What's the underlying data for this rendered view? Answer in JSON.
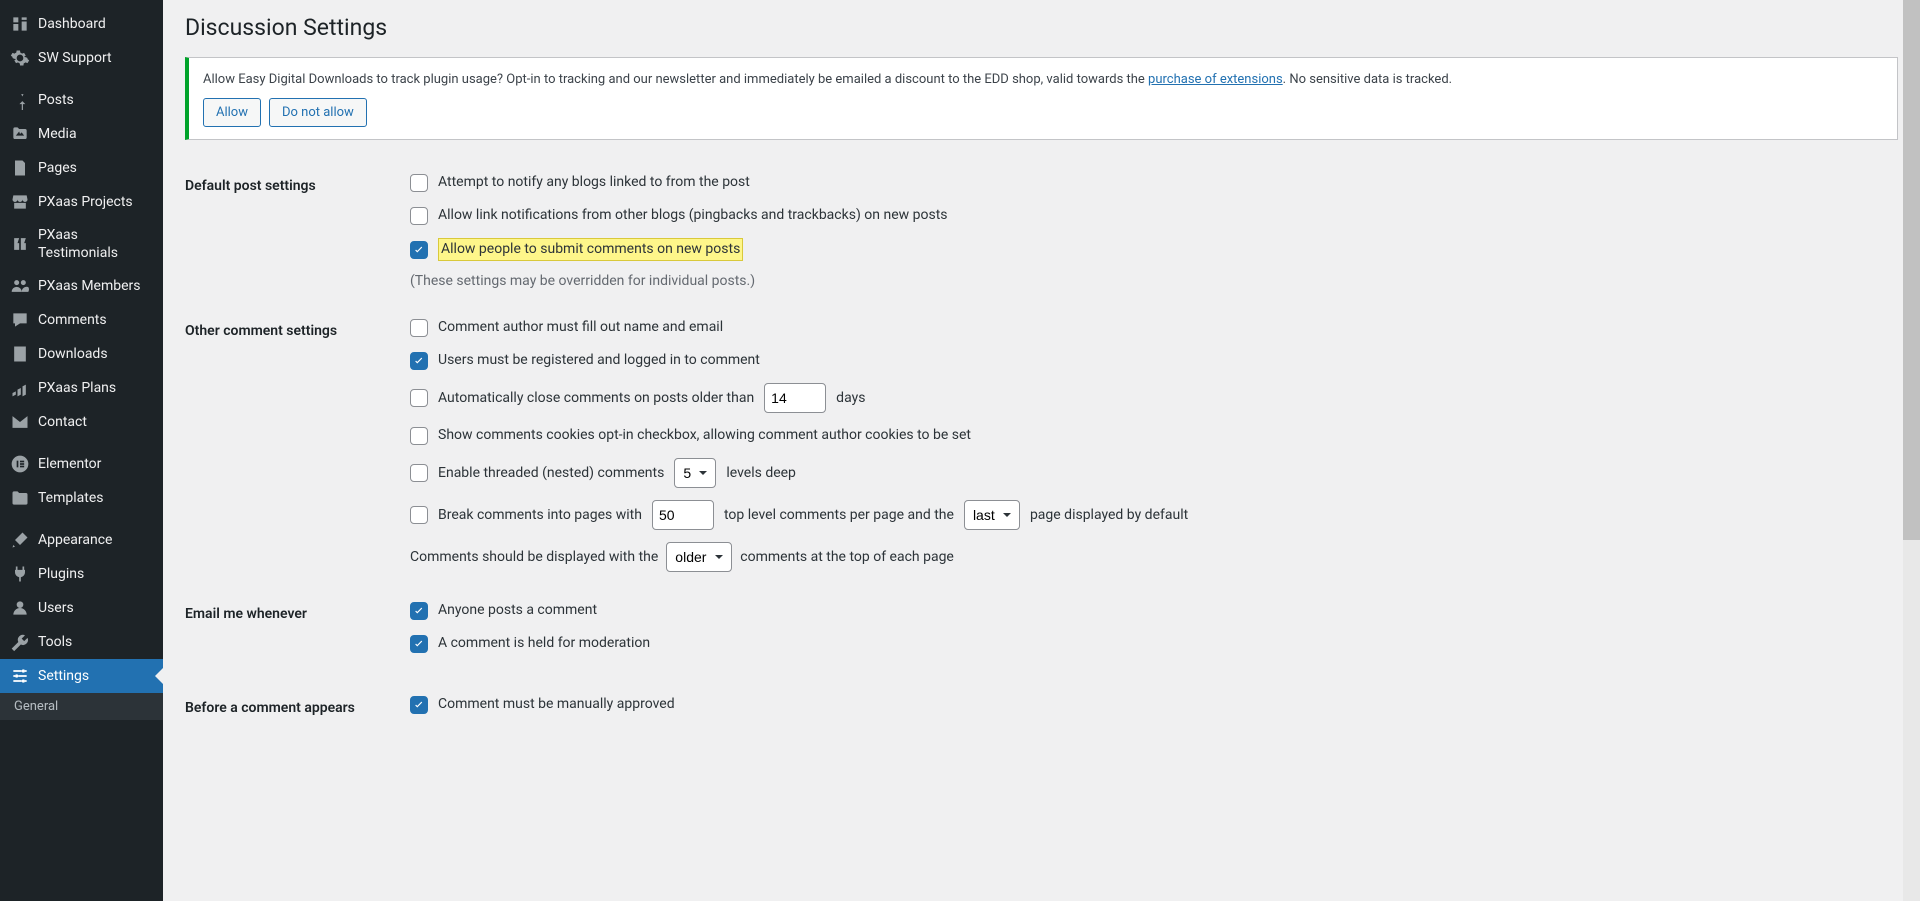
{
  "sidebar": {
    "items": [
      {
        "label": "Dashboard",
        "icon": "dash"
      },
      {
        "label": "SW Support",
        "icon": "gear"
      },
      {
        "label": "Posts",
        "icon": "pin"
      },
      {
        "label": "Media",
        "icon": "media"
      },
      {
        "label": "Pages",
        "icon": "page"
      },
      {
        "label": "PXaas Projects",
        "icon": "store"
      },
      {
        "label": "PXaas Testimonials",
        "icon": "quote"
      },
      {
        "label": "PXaas Members",
        "icon": "users"
      },
      {
        "label": "Comments",
        "icon": "comment"
      },
      {
        "label": "Downloads",
        "icon": "download"
      },
      {
        "label": "PXaas Plans",
        "icon": "plans"
      },
      {
        "label": "Contact",
        "icon": "mail"
      },
      {
        "label": "Elementor",
        "icon": "elementor"
      },
      {
        "label": "Templates",
        "icon": "folder"
      },
      {
        "label": "Appearance",
        "icon": "brush"
      },
      {
        "label": "Plugins",
        "icon": "plug"
      },
      {
        "label": "Users",
        "icon": "user"
      },
      {
        "label": "Tools",
        "icon": "wrench"
      },
      {
        "label": "Settings",
        "icon": "settings",
        "current": true
      }
    ],
    "sub_items": [
      {
        "label": "General"
      }
    ]
  },
  "page": {
    "title": "Discussion Settings"
  },
  "notice": {
    "text_before": "Allow Easy Digital Downloads to track plugin usage? Opt-in to tracking and our newsletter and immediately be emailed a discount to the EDD shop, valid towards the ",
    "link_text": "purchase of extensions",
    "text_after": ". No sensitive data is tracked.",
    "allow_label": "Allow",
    "deny_label": "Do not allow"
  },
  "sections": {
    "default_post": {
      "heading": "Default post settings",
      "opt_notify": "Attempt to notify any blogs linked to from the post",
      "opt_pingback": "Allow link notifications from other blogs (pingbacks and trackbacks) on new posts",
      "opt_allow_comments": "Allow people to submit comments on new posts",
      "note": "(These settings may be overridden for individual posts.)"
    },
    "other_comment": {
      "heading": "Other comment settings",
      "opt_name_email": "Comment author must fill out name and email",
      "opt_register": "Users must be registered and logged in to comment",
      "opt_close_before": "Automatically close comments on posts older than",
      "opt_close_value": "14",
      "opt_close_after": "days",
      "opt_cookies": "Show comments cookies opt-in checkbox, allowing comment author cookies to be set",
      "opt_threaded_before": "Enable threaded (nested) comments",
      "opt_threaded_value": "5",
      "opt_threaded_after": "levels deep",
      "opt_break_before": "Break comments into pages with",
      "opt_break_value": "50",
      "opt_break_mid": "top level comments per page and the",
      "opt_break_select": "last",
      "opt_break_after": "page displayed by default",
      "display_before": "Comments should be displayed with the",
      "display_select": "older",
      "display_after": "comments at the top of each page"
    },
    "email_me": {
      "heading": "Email me whenever",
      "opt_anyone": "Anyone posts a comment",
      "opt_held": "A comment is held for moderation"
    },
    "before_appear": {
      "heading": "Before a comment appears",
      "opt_manual": "Comment must be manually approved"
    }
  }
}
